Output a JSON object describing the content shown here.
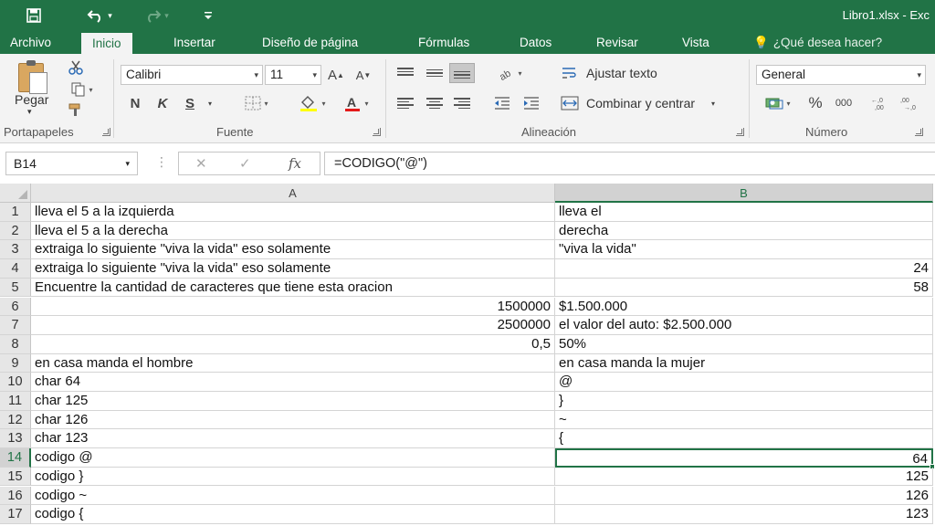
{
  "window": {
    "title": "Libro1.xlsx - Exc"
  },
  "qat": {
    "save_icon": "save-icon",
    "undo_icon": "undo-icon",
    "redo_icon": "redo-icon",
    "customize_icon": "customize-qat-icon"
  },
  "tabs": [
    {
      "label": "Archivo"
    },
    {
      "label": "Inicio"
    },
    {
      "label": "Insertar"
    },
    {
      "label": "Diseño de página"
    },
    {
      "label": "Fórmulas"
    },
    {
      "label": "Datos"
    },
    {
      "label": "Revisar"
    },
    {
      "label": "Vista"
    }
  ],
  "tell_me": "¿Qué desea hacer?",
  "ribbon": {
    "clipboard": {
      "paste_label": "Pegar",
      "group_label": "Portapapeles"
    },
    "font": {
      "name": "Calibri",
      "size": "11",
      "group_label": "Fuente",
      "bold": "N",
      "italic": "K",
      "underline": "S"
    },
    "alignment": {
      "wrap_label": "Ajustar texto",
      "merge_label": "Combinar y centrar",
      "group_label": "Alineación"
    },
    "number": {
      "format": "General",
      "group_label": "Número",
      "percent": "%",
      "thousands": "000"
    }
  },
  "formula_bar": {
    "name_box": "B14",
    "formula": "=CODIGO(\"@\")",
    "fx_label": "fx"
  },
  "columns": [
    "A",
    "B"
  ],
  "rows": [
    {
      "num": "1",
      "a": "lleva el 5 a la izquierda",
      "b": "lleva el"
    },
    {
      "num": "2",
      "a": "lleva el 5 a la derecha",
      "b": "derecha"
    },
    {
      "num": "3",
      "a": "extraiga lo siguiente \"viva la vida\" eso solamente",
      "b": "\"viva la vida\""
    },
    {
      "num": "4",
      "a": "extraiga lo siguiente \"viva la vida\" eso solamente",
      "b": "24"
    },
    {
      "num": "5",
      "a": "Encuentre la cantidad de caracteres que tiene esta oracion",
      "b": "58"
    },
    {
      "num": "6",
      "a": "1500000",
      "b": "$1.500.000"
    },
    {
      "num": "7",
      "a": "2500000",
      "b": "el valor del auto: $2.500.000"
    },
    {
      "num": "8",
      "a": "0,5",
      "b": "50%"
    },
    {
      "num": "9",
      "a": "en casa manda el hombre",
      "b": "en casa manda la mujer"
    },
    {
      "num": "10",
      "a": "char 64",
      "b": "@"
    },
    {
      "num": "11",
      "a": "char 125",
      "b": "}"
    },
    {
      "num": "12",
      "a": "char 126",
      "b": "~"
    },
    {
      "num": "13",
      "a": "char 123",
      "b": "{"
    },
    {
      "num": "14",
      "a": "codigo @",
      "b": "64"
    },
    {
      "num": "15",
      "a": "codigo }",
      "b": "125"
    },
    {
      "num": "16",
      "a": "codigo ~",
      "b": "126"
    },
    {
      "num": "17",
      "a": "codigo {",
      "b": "123"
    }
  ],
  "colors": {
    "excel_green": "#217346",
    "ribbon_bg": "#f3f3f3"
  }
}
